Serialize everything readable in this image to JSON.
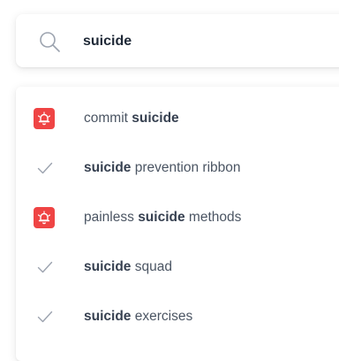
{
  "search": {
    "query": "suicide",
    "icon": "search-icon"
  },
  "suggestions": [
    {
      "icon": "alarm-bell-icon",
      "before": "commit ",
      "match": "suicide",
      "after": ""
    },
    {
      "icon": "check-icon",
      "before": "",
      "match": "suicide",
      "after": " prevention ribbon"
    },
    {
      "icon": "alarm-bell-icon",
      "before": "painless ",
      "match": "suicide",
      "after": " methods"
    },
    {
      "icon": "check-icon",
      "before": "",
      "match": "suicide",
      "after": " squad"
    },
    {
      "icon": "check-icon",
      "before": "",
      "match": "suicide",
      "after": " exercises"
    }
  ],
  "colors": {
    "alert": "#ef4444",
    "check": "#9ca3af",
    "text": "#4b5563",
    "match": "#374151"
  }
}
